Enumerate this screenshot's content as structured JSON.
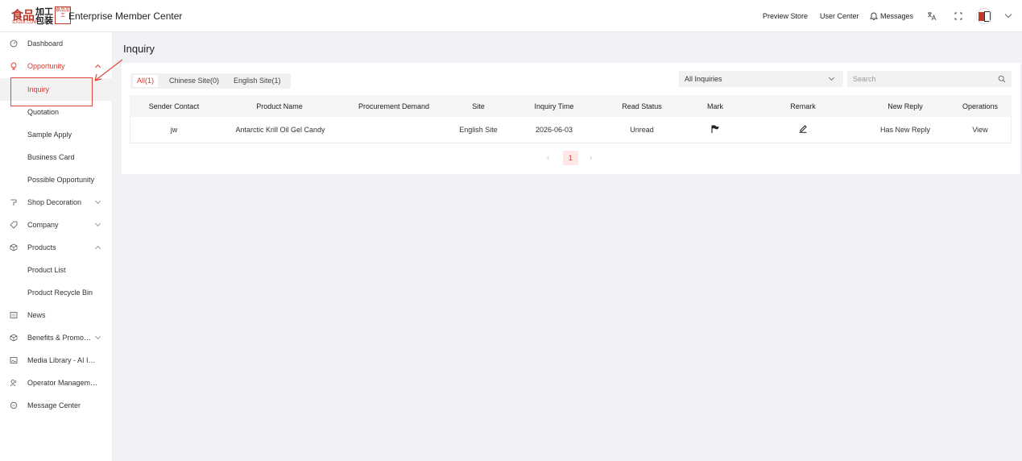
{
  "header": {
    "logo": {
      "cn_main": "食品",
      "cn_side": "加工包装",
      "sub": "SJGLB.COM",
      "box_text": "食品加工"
    },
    "title": "Enterprise Member Center",
    "preview_store": "Preview Store",
    "user_center": "User Center",
    "messages": "Messages",
    "icons": [
      "bell-icon",
      "translate-icon",
      "fullscreen-icon",
      "avatar",
      "chevron-down-icon"
    ]
  },
  "sidebar": {
    "items": [
      {
        "label": "Dashboard",
        "icon": "dashboard-icon"
      },
      {
        "label": "Opportunity",
        "icon": "lightbulb-icon",
        "expanded": true
      },
      {
        "label": "Inquiry",
        "selected": true
      },
      {
        "label": "Quotation"
      },
      {
        "label": "Sample Apply"
      },
      {
        "label": "Business Card"
      },
      {
        "label": "Possible Opportunity"
      },
      {
        "label": "Shop Decoration",
        "icon": "brush-icon"
      },
      {
        "label": "Company",
        "icon": "tag-icon"
      },
      {
        "label": "Products",
        "icon": "cube-icon",
        "expanded": true
      },
      {
        "label": "Product List"
      },
      {
        "label": "Product Recycle Bin"
      },
      {
        "label": "News",
        "icon": "news-icon"
      },
      {
        "label": "Benefits & Promo…",
        "icon": "gift-icon"
      },
      {
        "label": "Media Library - AI I…",
        "icon": "image-icon"
      },
      {
        "label": "Operator Managem…",
        "icon": "users-icon"
      },
      {
        "label": "Message Center",
        "icon": "chat-icon"
      }
    ]
  },
  "main": {
    "page_title": "Inquiry",
    "tabs": [
      {
        "label": "All(1)",
        "active": true
      },
      {
        "label": "Chinese Site(0)"
      },
      {
        "label": "English Site(1)"
      }
    ],
    "filter": {
      "selected": "All Inquiries"
    },
    "search": {
      "placeholder": "Search"
    },
    "table": {
      "columns": [
        "Sender Contact",
        "Product Name",
        "Procurement Demand",
        "Site",
        "Inquiry Time",
        "Read Status",
        "Mark",
        "Remark",
        "New Reply",
        "Operations"
      ],
      "rows": [
        {
          "sender": "jw",
          "product": "Antarctic Krill Oil Gel Candy",
          "demand": "",
          "site": "English Site",
          "time": "2026-06-03",
          "status": "Unread",
          "mark_icon": "flag-icon",
          "remark_icon": "edit-icon",
          "new_reply": "Has New Reply",
          "operation": "View"
        }
      ]
    },
    "pagination": {
      "current": "1",
      "prev": "‹",
      "next": "›"
    }
  },
  "colors": {
    "accent": "#d63a2f",
    "annotation": "#e0463a",
    "background": "#f0f2f5"
  }
}
